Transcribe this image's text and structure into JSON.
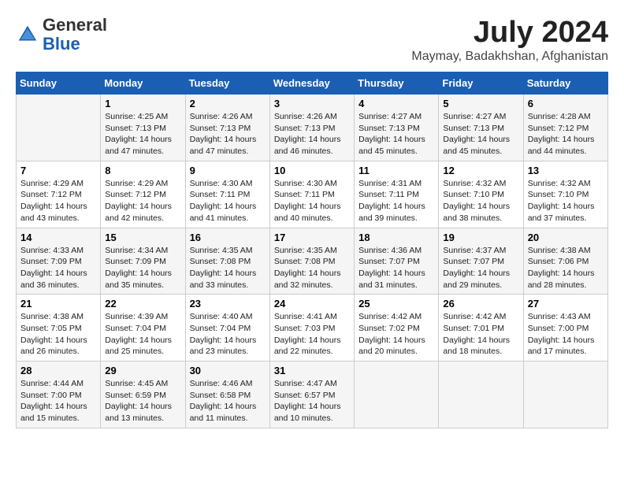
{
  "header": {
    "logo_line1": "General",
    "logo_line2": "Blue",
    "month_year": "July 2024",
    "location": "Maymay, Badakhshan, Afghanistan"
  },
  "days_of_week": [
    "Sunday",
    "Monday",
    "Tuesday",
    "Wednesday",
    "Thursday",
    "Friday",
    "Saturday"
  ],
  "weeks": [
    [
      {
        "day": "",
        "content": ""
      },
      {
        "day": "1",
        "content": "Sunrise: 4:25 AM\nSunset: 7:13 PM\nDaylight: 14 hours\nand 47 minutes."
      },
      {
        "day": "2",
        "content": "Sunrise: 4:26 AM\nSunset: 7:13 PM\nDaylight: 14 hours\nand 47 minutes."
      },
      {
        "day": "3",
        "content": "Sunrise: 4:26 AM\nSunset: 7:13 PM\nDaylight: 14 hours\nand 46 minutes."
      },
      {
        "day": "4",
        "content": "Sunrise: 4:27 AM\nSunset: 7:13 PM\nDaylight: 14 hours\nand 45 minutes."
      },
      {
        "day": "5",
        "content": "Sunrise: 4:27 AM\nSunset: 7:13 PM\nDaylight: 14 hours\nand 45 minutes."
      },
      {
        "day": "6",
        "content": "Sunrise: 4:28 AM\nSunset: 7:12 PM\nDaylight: 14 hours\nand 44 minutes."
      }
    ],
    [
      {
        "day": "7",
        "content": "Sunrise: 4:29 AM\nSunset: 7:12 PM\nDaylight: 14 hours\nand 43 minutes."
      },
      {
        "day": "8",
        "content": "Sunrise: 4:29 AM\nSunset: 7:12 PM\nDaylight: 14 hours\nand 42 minutes."
      },
      {
        "day": "9",
        "content": "Sunrise: 4:30 AM\nSunset: 7:11 PM\nDaylight: 14 hours\nand 41 minutes."
      },
      {
        "day": "10",
        "content": "Sunrise: 4:30 AM\nSunset: 7:11 PM\nDaylight: 14 hours\nand 40 minutes."
      },
      {
        "day": "11",
        "content": "Sunrise: 4:31 AM\nSunset: 7:11 PM\nDaylight: 14 hours\nand 39 minutes."
      },
      {
        "day": "12",
        "content": "Sunrise: 4:32 AM\nSunset: 7:10 PM\nDaylight: 14 hours\nand 38 minutes."
      },
      {
        "day": "13",
        "content": "Sunrise: 4:32 AM\nSunset: 7:10 PM\nDaylight: 14 hours\nand 37 minutes."
      }
    ],
    [
      {
        "day": "14",
        "content": "Sunrise: 4:33 AM\nSunset: 7:09 PM\nDaylight: 14 hours\nand 36 minutes."
      },
      {
        "day": "15",
        "content": "Sunrise: 4:34 AM\nSunset: 7:09 PM\nDaylight: 14 hours\nand 35 minutes."
      },
      {
        "day": "16",
        "content": "Sunrise: 4:35 AM\nSunset: 7:08 PM\nDaylight: 14 hours\nand 33 minutes."
      },
      {
        "day": "17",
        "content": "Sunrise: 4:35 AM\nSunset: 7:08 PM\nDaylight: 14 hours\nand 32 minutes."
      },
      {
        "day": "18",
        "content": "Sunrise: 4:36 AM\nSunset: 7:07 PM\nDaylight: 14 hours\nand 31 minutes."
      },
      {
        "day": "19",
        "content": "Sunrise: 4:37 AM\nSunset: 7:07 PM\nDaylight: 14 hours\nand 29 minutes."
      },
      {
        "day": "20",
        "content": "Sunrise: 4:38 AM\nSunset: 7:06 PM\nDaylight: 14 hours\nand 28 minutes."
      }
    ],
    [
      {
        "day": "21",
        "content": "Sunrise: 4:38 AM\nSunset: 7:05 PM\nDaylight: 14 hours\nand 26 minutes."
      },
      {
        "day": "22",
        "content": "Sunrise: 4:39 AM\nSunset: 7:04 PM\nDaylight: 14 hours\nand 25 minutes."
      },
      {
        "day": "23",
        "content": "Sunrise: 4:40 AM\nSunset: 7:04 PM\nDaylight: 14 hours\nand 23 minutes."
      },
      {
        "day": "24",
        "content": "Sunrise: 4:41 AM\nSunset: 7:03 PM\nDaylight: 14 hours\nand 22 minutes."
      },
      {
        "day": "25",
        "content": "Sunrise: 4:42 AM\nSunset: 7:02 PM\nDaylight: 14 hours\nand 20 minutes."
      },
      {
        "day": "26",
        "content": "Sunrise: 4:42 AM\nSunset: 7:01 PM\nDaylight: 14 hours\nand 18 minutes."
      },
      {
        "day": "27",
        "content": "Sunrise: 4:43 AM\nSunset: 7:00 PM\nDaylight: 14 hours\nand 17 minutes."
      }
    ],
    [
      {
        "day": "28",
        "content": "Sunrise: 4:44 AM\nSunset: 7:00 PM\nDaylight: 14 hours\nand 15 minutes."
      },
      {
        "day": "29",
        "content": "Sunrise: 4:45 AM\nSunset: 6:59 PM\nDaylight: 14 hours\nand 13 minutes."
      },
      {
        "day": "30",
        "content": "Sunrise: 4:46 AM\nSunset: 6:58 PM\nDaylight: 14 hours\nand 11 minutes."
      },
      {
        "day": "31",
        "content": "Sunrise: 4:47 AM\nSunset: 6:57 PM\nDaylight: 14 hours\nand 10 minutes."
      },
      {
        "day": "",
        "content": ""
      },
      {
        "day": "",
        "content": ""
      },
      {
        "day": "",
        "content": ""
      }
    ]
  ]
}
